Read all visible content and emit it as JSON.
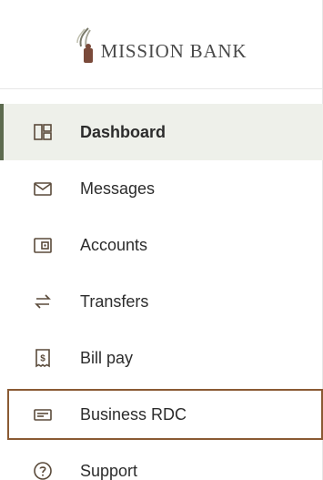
{
  "brand": {
    "name": "MISSION BANK"
  },
  "nav": {
    "items": [
      {
        "label": "Dashboard",
        "icon": "dashboard-icon",
        "active": true
      },
      {
        "label": "Messages",
        "icon": "envelope-icon"
      },
      {
        "label": "Accounts",
        "icon": "wallet-icon"
      },
      {
        "label": "Transfers",
        "icon": "transfer-arrows-icon"
      },
      {
        "label": "Bill pay",
        "icon": "bill-dollar-icon"
      },
      {
        "label": "Business RDC",
        "icon": "check-deposit-icon",
        "focused": true
      },
      {
        "label": "Support",
        "icon": "question-circle-icon"
      }
    ]
  },
  "colors": {
    "active_bar": "#5d6b4f",
    "active_bg": "#eef0ea",
    "focus_border": "#8a5a33",
    "icon": "#5a4a3a"
  }
}
